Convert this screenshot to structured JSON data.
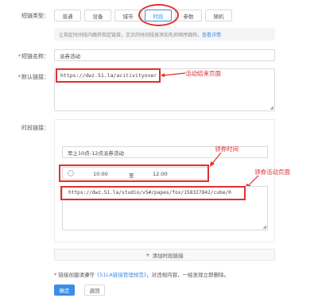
{
  "type_row": {
    "label": "短链类型：",
    "tabs": [
      {
        "label": "普通",
        "active": false
      },
      {
        "label": "设备",
        "active": false
      },
      {
        "label": "城市",
        "active": false
      },
      {
        "label": "时段",
        "active": true
      },
      {
        "label": "参数",
        "active": false
      },
      {
        "label": "随机",
        "active": false
      }
    ]
  },
  "notice": {
    "text": "让指定时间段内跳转指定链接，交叉的时间段按添加先后顺序跳转。",
    "link": "查看详情"
  },
  "name_row": {
    "label": "短链名称：",
    "value": "派券活动"
  },
  "default_row": {
    "label": "默认链接：",
    "value": "https://dwz.51.la/acitivityover"
  },
  "period_row": {
    "label": "时段链接："
  },
  "period_card": {
    "name_value": "早上10点-12点派券活动",
    "time_start": "10:00",
    "time_sep": "至",
    "time_end": "12:00",
    "url_value": "https://dwz.51.la/studio/v5#/papes/fox/158327842/cube/0"
  },
  "add_period_label": "添加时段链接",
  "add_period_plus": "+",
  "policy": {
    "star": "*",
    "prefix": "链接创建请遵守",
    "link": "《51LA链接管理规范》",
    "suffix": "，对违规内容，一经发现立即删除。"
  },
  "buttons": {
    "confirm": "确定",
    "back": "返回"
  },
  "annotations": {
    "default": "活动结束页面",
    "time": "领券时间",
    "page": "领券活动页面"
  },
  "colors": {
    "accent": "#3a8ee6",
    "annotation": "#e03030"
  }
}
